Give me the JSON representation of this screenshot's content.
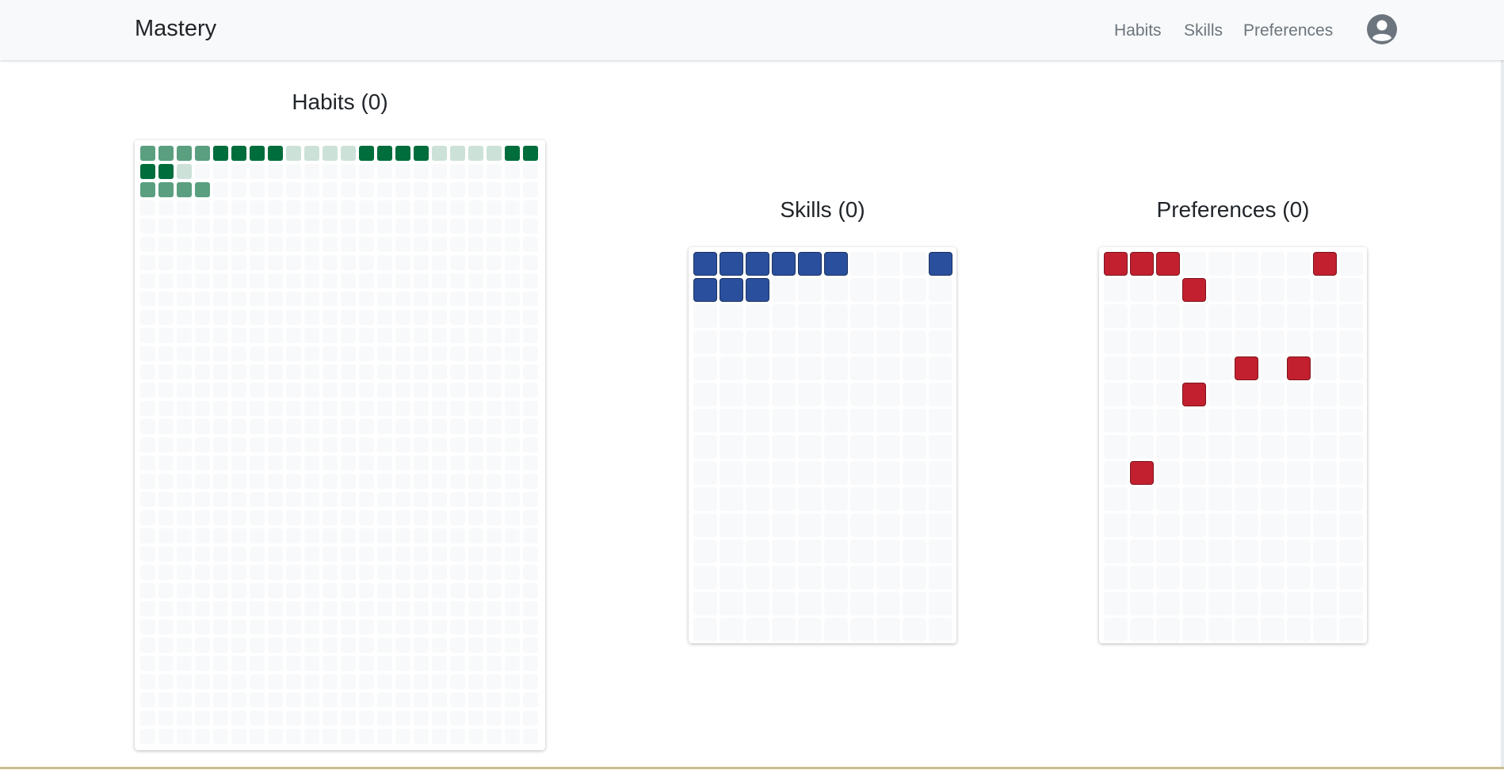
{
  "navbar": {
    "brand": "Mastery",
    "links": [
      "Habits",
      "Skills",
      "Preferences"
    ],
    "avatar_icon": "user-circle-icon"
  },
  "habits": {
    "title": "Habits (0)",
    "columns": 22,
    "rows": 33,
    "empty_color": "#f8f9fa",
    "colors": {
      "dark": "#006d3c",
      "medium": "#5a9f80",
      "light": "#cce2d8"
    },
    "filled": [
      {
        "row": 0,
        "col": 0,
        "shade": "medium"
      },
      {
        "row": 0,
        "col": 1,
        "shade": "medium"
      },
      {
        "row": 0,
        "col": 2,
        "shade": "medium"
      },
      {
        "row": 0,
        "col": 3,
        "shade": "medium"
      },
      {
        "row": 0,
        "col": 4,
        "shade": "dark"
      },
      {
        "row": 0,
        "col": 5,
        "shade": "dark"
      },
      {
        "row": 0,
        "col": 6,
        "shade": "dark"
      },
      {
        "row": 0,
        "col": 7,
        "shade": "dark"
      },
      {
        "row": 0,
        "col": 8,
        "shade": "light"
      },
      {
        "row": 0,
        "col": 9,
        "shade": "light"
      },
      {
        "row": 0,
        "col": 10,
        "shade": "light"
      },
      {
        "row": 0,
        "col": 11,
        "shade": "light"
      },
      {
        "row": 0,
        "col": 12,
        "shade": "dark"
      },
      {
        "row": 0,
        "col": 13,
        "shade": "dark"
      },
      {
        "row": 0,
        "col": 14,
        "shade": "dark"
      },
      {
        "row": 0,
        "col": 15,
        "shade": "dark"
      },
      {
        "row": 0,
        "col": 16,
        "shade": "light"
      },
      {
        "row": 0,
        "col": 17,
        "shade": "light"
      },
      {
        "row": 0,
        "col": 18,
        "shade": "light"
      },
      {
        "row": 0,
        "col": 19,
        "shade": "light"
      },
      {
        "row": 0,
        "col": 20,
        "shade": "dark"
      },
      {
        "row": 0,
        "col": 21,
        "shade": "dark"
      },
      {
        "row": 1,
        "col": 0,
        "shade": "dark"
      },
      {
        "row": 1,
        "col": 1,
        "shade": "dark"
      },
      {
        "row": 1,
        "col": 2,
        "shade": "light"
      },
      {
        "row": 2,
        "col": 0,
        "shade": "medium"
      },
      {
        "row": 2,
        "col": 1,
        "shade": "medium"
      },
      {
        "row": 2,
        "col": 2,
        "shade": "medium"
      },
      {
        "row": 2,
        "col": 3,
        "shade": "medium"
      }
    ]
  },
  "skills": {
    "title": "Skills (0)",
    "columns": 10,
    "rows": 15,
    "empty_color": "#f8f9fa",
    "color": "#2a4f9c",
    "filled": [
      {
        "row": 0,
        "col": 0
      },
      {
        "row": 0,
        "col": 1
      },
      {
        "row": 0,
        "col": 2
      },
      {
        "row": 0,
        "col": 3
      },
      {
        "row": 0,
        "col": 4
      },
      {
        "row": 0,
        "col": 5
      },
      {
        "row": 0,
        "col": 9
      },
      {
        "row": 1,
        "col": 0
      },
      {
        "row": 1,
        "col": 1
      },
      {
        "row": 1,
        "col": 2
      }
    ]
  },
  "preferences": {
    "title": "Preferences (0)",
    "columns": 10,
    "rows": 15,
    "empty_color": "#f8f9fa",
    "color": "#c2202f",
    "filled": [
      {
        "row": 0,
        "col": 0
      },
      {
        "row": 0,
        "col": 1
      },
      {
        "row": 0,
        "col": 2
      },
      {
        "row": 0,
        "col": 8
      },
      {
        "row": 1,
        "col": 3
      },
      {
        "row": 4,
        "col": 5
      },
      {
        "row": 4,
        "col": 7
      },
      {
        "row": 5,
        "col": 3
      },
      {
        "row": 8,
        "col": 1
      }
    ]
  }
}
